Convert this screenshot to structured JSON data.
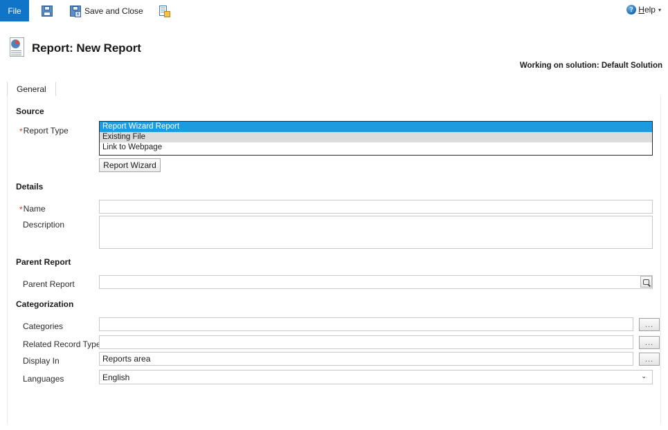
{
  "commandbar": {
    "file_tab": "File",
    "save_label": "",
    "save_and_close_label": "Save and Close",
    "new_label": "",
    "save_icon_badge": "",
    "save_close_icon_badge": "x"
  },
  "help": {
    "icon": "help-icon",
    "label_prefix": "",
    "label_underlined": "H",
    "label_rest": "elp",
    "caret": "▾",
    "glyph": "?"
  },
  "record": {
    "title": "Report: New Report",
    "solution_note": "Working on solution: Default Solution"
  },
  "tabs": [
    {
      "label": "General"
    }
  ],
  "sections": {
    "source": {
      "heading": "Source",
      "report_type": {
        "label": "Report Type",
        "required": "*",
        "options": [
          "Report Wizard Report",
          "Existing File",
          "Link to Webpage"
        ],
        "selected_index": 0
      },
      "report_wizard_button": "Report Wizard"
    },
    "details": {
      "heading": "Details",
      "name": {
        "label": "Name",
        "required": "*",
        "value": "",
        "placeholder": ""
      },
      "description": {
        "label": "Description",
        "value": "",
        "placeholder": ""
      }
    },
    "parent_report": {
      "heading": "Parent Report",
      "field": {
        "label": "Parent Report",
        "value": "",
        "placeholder": "",
        "lookup_icon": "lookup-icon"
      }
    },
    "categorization": {
      "heading": "Categorization",
      "categories": {
        "label": "Categories",
        "value": "",
        "placeholder": "",
        "button": "..."
      },
      "related_record_types": {
        "label": "Related Record Types",
        "value": "",
        "placeholder": "",
        "button": "..."
      },
      "display_in": {
        "label": "Display In",
        "value": "Reports area",
        "placeholder": "",
        "button": "..."
      },
      "languages": {
        "label": "Languages",
        "value": "English",
        "options": [
          "English"
        ],
        "caret": "⌄"
      }
    }
  },
  "colors": {
    "file_tab_blue": "#1075c8",
    "selection_blue": "#1c9ce0",
    "required_red": "#d1342f",
    "alt_row_gray": "#dcdcdc"
  }
}
